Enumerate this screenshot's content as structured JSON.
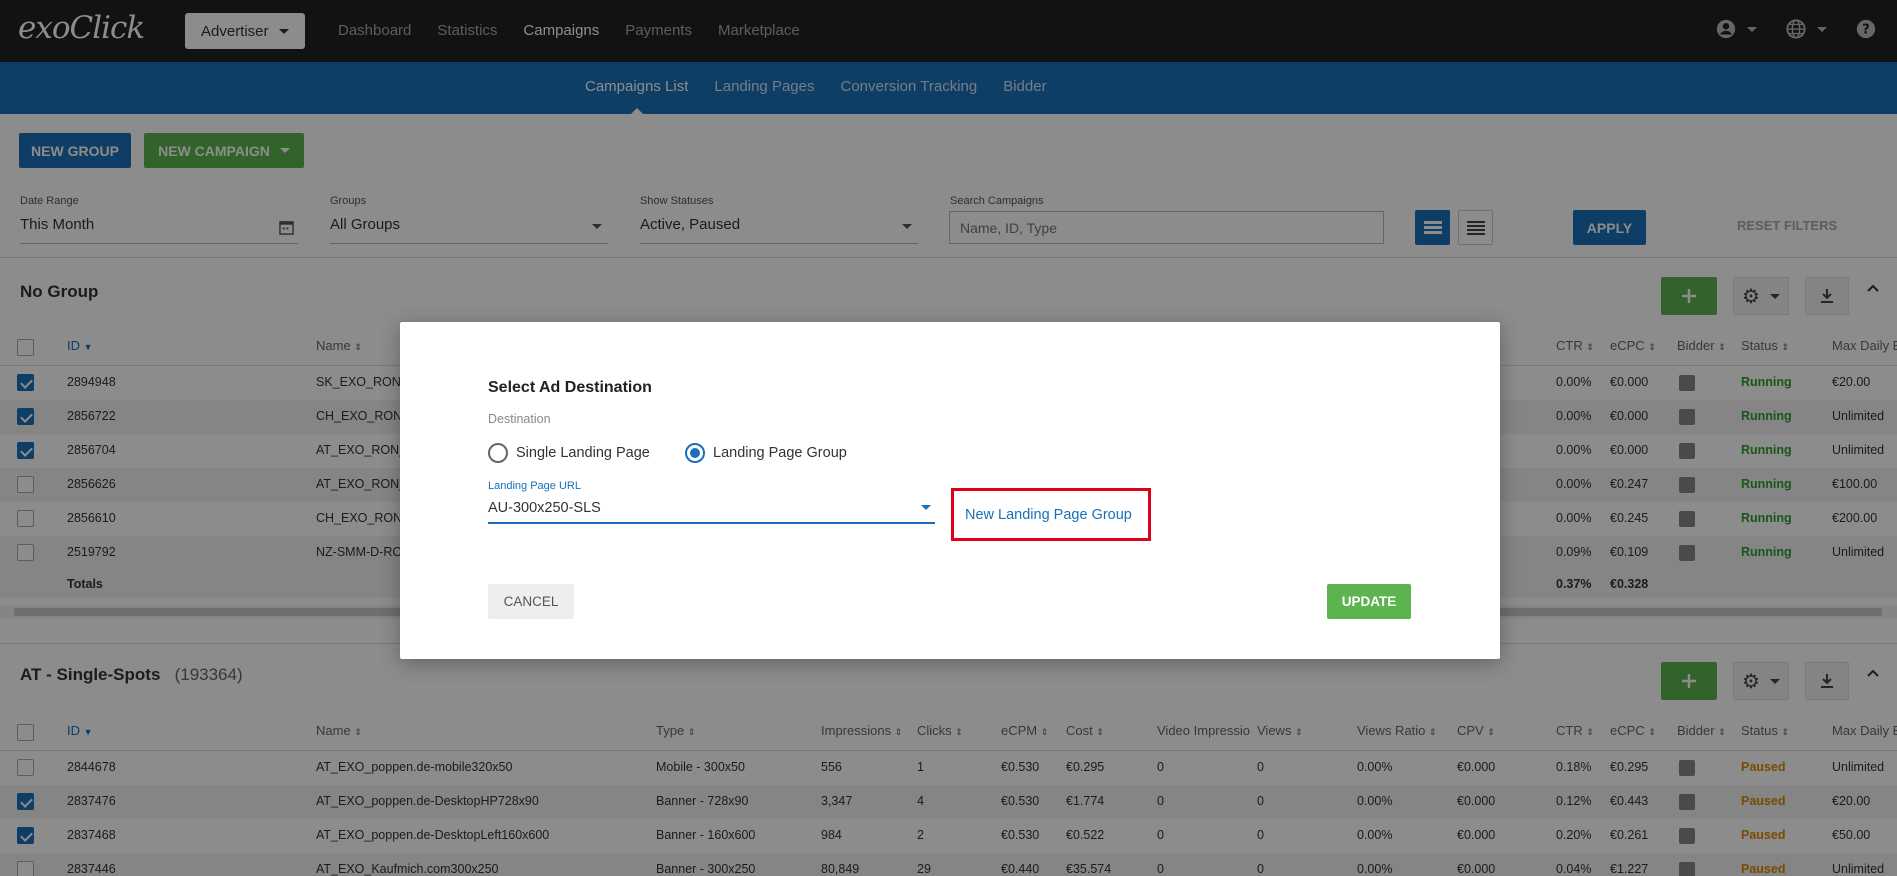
{
  "header": {
    "logo": "exoClick",
    "account_menu": "Advertiser",
    "nav": [
      "Dashboard",
      "Statistics",
      "Campaigns",
      "Payments",
      "Marketplace"
    ],
    "active_nav": "Campaigns",
    "icons": [
      "user-icon",
      "globe-icon",
      "help-icon"
    ]
  },
  "subnav": {
    "items": [
      "Campaigns List",
      "Landing Pages",
      "Conversion Tracking",
      "Bidder"
    ],
    "active": "Campaigns List"
  },
  "toolbar": {
    "new_group": "NEW GROUP",
    "new_campaign": "NEW CAMPAIGN"
  },
  "filters": {
    "date_range": {
      "label": "Date Range",
      "value": "This Month"
    },
    "groups": {
      "label": "Groups",
      "value": "All Groups"
    },
    "statuses": {
      "label": "Show Statuses",
      "value": "Active, Paused"
    },
    "search": {
      "label": "Search Campaigns",
      "placeholder": "Name, ID, Type"
    },
    "apply": "APPLY",
    "reset": "RESET FILTERS"
  },
  "group1": {
    "title": "No Group",
    "headers": {
      "id": "ID",
      "name": "Name",
      "ctr": "CTR",
      "ecpc": "eCPC",
      "bidder": "Bidder",
      "status": "Status",
      "max_daily": "Max Daily B"
    },
    "rows": [
      {
        "checked": true,
        "id": "2894948",
        "name": "SK_EXO_RON_",
        "ctr": "0.00%",
        "ecpc": "€0.000",
        "status": "Running",
        "max": "€20.00"
      },
      {
        "checked": true,
        "id": "2856722",
        "name": "CH_EXO_RON_",
        "ctr": "0.00%",
        "ecpc": "€0.000",
        "status": "Running",
        "max": "Unlimited"
      },
      {
        "checked": true,
        "id": "2856704",
        "name": "AT_EXO_RON_",
        "ctr": "0.00%",
        "ecpc": "€0.000",
        "status": "Running",
        "max": "Unlimited"
      },
      {
        "checked": false,
        "id": "2856626",
        "name": "AT_EXO_RON_",
        "ctr": "0.00%",
        "ecpc": "€0.247",
        "status": "Running",
        "max": "€100.00"
      },
      {
        "checked": false,
        "id": "2856610",
        "name": "CH_EXO_RON_",
        "ctr": "0.00%",
        "ecpc": "€0.245",
        "status": "Running",
        "max": "€200.00"
      },
      {
        "checked": false,
        "id": "2519792",
        "name": "NZ-SMM-D-RO",
        "ctr": "0.09%",
        "ecpc": "€0.109",
        "status": "Running",
        "max": "Unlimited"
      }
    ],
    "totals": {
      "label": "Totals",
      "ctr": "0.37%",
      "ecpc": "€0.328"
    }
  },
  "group2": {
    "title": "AT - Single-Spots",
    "count": "(193364)",
    "headers": {
      "id": "ID",
      "name": "Name",
      "type": "Type",
      "impressions": "Impressions",
      "clicks": "Clicks",
      "ecpm": "eCPM",
      "cost": "Cost",
      "video_impressions": "Video Impressio",
      "views": "Views",
      "views_ratio": "Views Ratio",
      "cpv": "CPV",
      "ctr": "CTR",
      "ecpc": "eCPC",
      "bidder": "Bidder",
      "status": "Status",
      "max_daily": "Max Daily B"
    },
    "rows": [
      {
        "checked": false,
        "id": "2844678",
        "name": "AT_EXO_poppen.de-mobile320x50",
        "type": "Mobile - 300x50",
        "impressions": "556",
        "clicks": "1",
        "ecpm": "€0.530",
        "cost": "€0.295",
        "video": "0",
        "views": "0",
        "ratio": "0.00%",
        "cpv": "€0.000",
        "ctr": "0.18%",
        "ecpc": "€0.295",
        "status": "Paused",
        "max": "Unlimited"
      },
      {
        "checked": true,
        "id": "2837476",
        "name": "AT_EXO_poppen.de-DesktopHP728x90",
        "type": "Banner - 728x90",
        "impressions": "3,347",
        "clicks": "4",
        "ecpm": "€0.530",
        "cost": "€1.774",
        "video": "0",
        "views": "0",
        "ratio": "0.00%",
        "cpv": "€0.000",
        "ctr": "0.12%",
        "ecpc": "€0.443",
        "status": "Paused",
        "max": "€20.00"
      },
      {
        "checked": true,
        "id": "2837468",
        "name": "AT_EXO_poppen.de-DesktopLeft160x600",
        "type": "Banner - 160x600",
        "impressions": "984",
        "clicks": "2",
        "ecpm": "€0.530",
        "cost": "€0.522",
        "video": "0",
        "views": "0",
        "ratio": "0.00%",
        "cpv": "€0.000",
        "ctr": "0.20%",
        "ecpc": "€0.261",
        "status": "Paused",
        "max": "€50.00"
      },
      {
        "checked": false,
        "id": "2837446",
        "name": "AT_EXO_Kaufmich.com300x250",
        "type": "Banner - 300x250",
        "impressions": "80,849",
        "clicks": "29",
        "ecpm": "€0.440",
        "cost": "€35.574",
        "video": "0",
        "views": "0",
        "ratio": "0.00%",
        "cpv": "€0.000",
        "ctr": "0.04%",
        "ecpc": "€1.227",
        "status": "Paused",
        "max": "Unlimited"
      }
    ]
  },
  "modal": {
    "title": "Select Ad Destination",
    "destination_label": "Destination",
    "option_single": "Single Landing Page",
    "option_group": "Landing Page Group",
    "selected": "Landing Page Group",
    "url_label": "Landing Page URL",
    "url_value": "AU-300x250-SLS",
    "new_group_link": "New Landing Page Group",
    "cancel": "CANCEL",
    "update": "UPDATE"
  },
  "colors": {
    "brand_blue": "#1a6fb8",
    "green": "#5cb44e",
    "running": "#2e9e2e",
    "paused": "#d98a00",
    "highlight": "#e0001b"
  }
}
